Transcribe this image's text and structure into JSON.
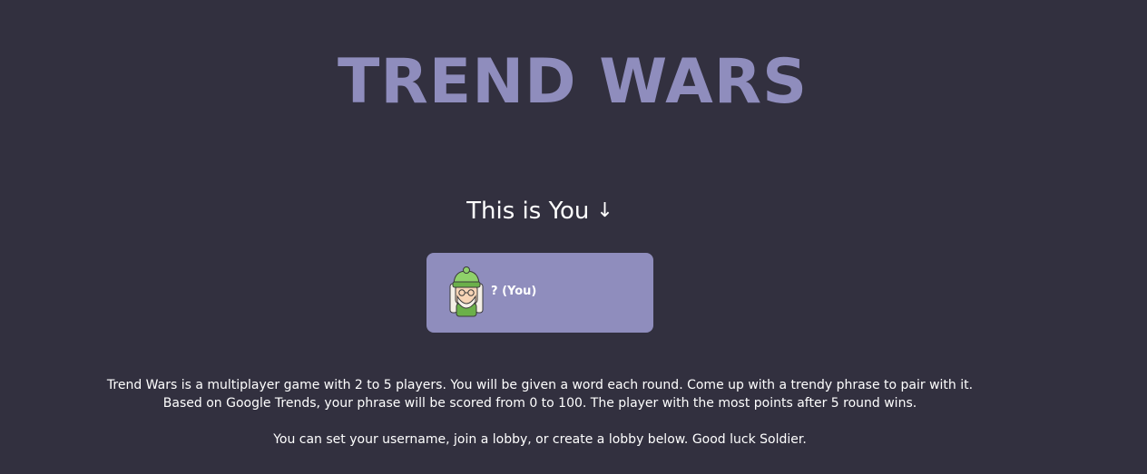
{
  "title": "TREND WARS",
  "you_section": {
    "heading": "This is You",
    "arrow_icon": "↓"
  },
  "player": {
    "name": "? (You)",
    "avatar_icon": "elf-avatar-icon",
    "card_color": "#8f8dbd"
  },
  "description": {
    "line1": "Trend Wars is a multiplayer game with 2 to 5 players. You will be given a word each round. Come up with a trendy phrase to pair with it.",
    "line2": "Based on Google Trends, your phrase will be scored from 0 to 100. The player with the most points after 5 round wins.",
    "line3": "You can set your username, join a lobby, or create a lobby below. Good luck Soldier."
  },
  "colors": {
    "background": "#32303f",
    "accent": "#8f8dbd",
    "text": "#ffffff"
  }
}
